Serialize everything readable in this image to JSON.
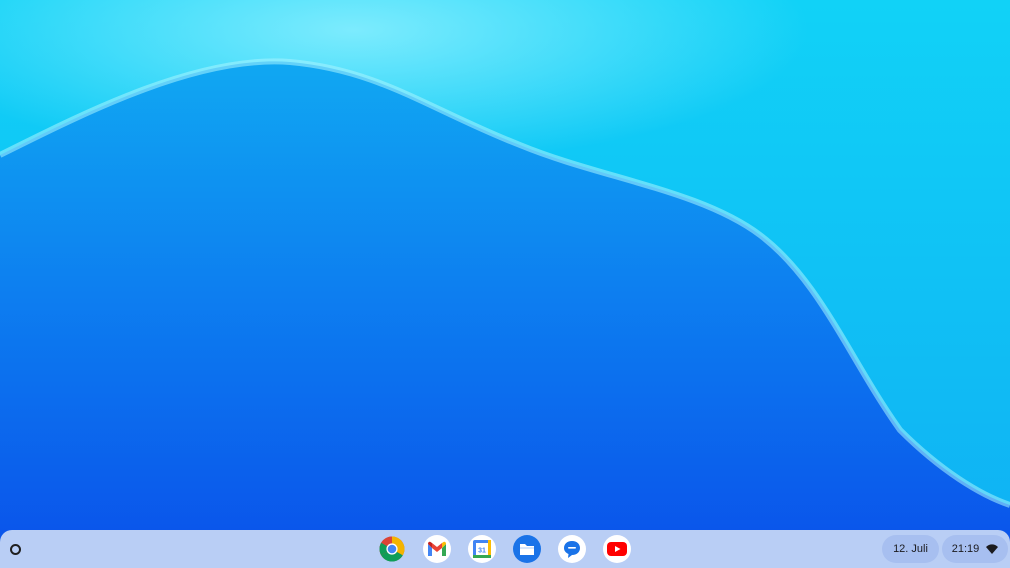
{
  "shelf": {
    "launcher_icon": "launcher-circle-icon",
    "apps": [
      {
        "name": "Chrome",
        "icon": "chrome-icon"
      },
      {
        "name": "Gmail",
        "icon": "gmail-icon"
      },
      {
        "name": "Calendar",
        "icon": "calendar-icon",
        "badge": "31"
      },
      {
        "name": "Files",
        "icon": "files-icon"
      },
      {
        "name": "Messages",
        "icon": "messages-icon"
      },
      {
        "name": "YouTube",
        "icon": "youtube-icon"
      }
    ],
    "date": "12. Juli",
    "time": "21:19",
    "status_icon": "wifi-icon"
  },
  "colors": {
    "shelf_bg": "#b9cef5",
    "wallpaper_top": "#12c4f4",
    "wallpaper_bottom": "#0a56ea"
  }
}
